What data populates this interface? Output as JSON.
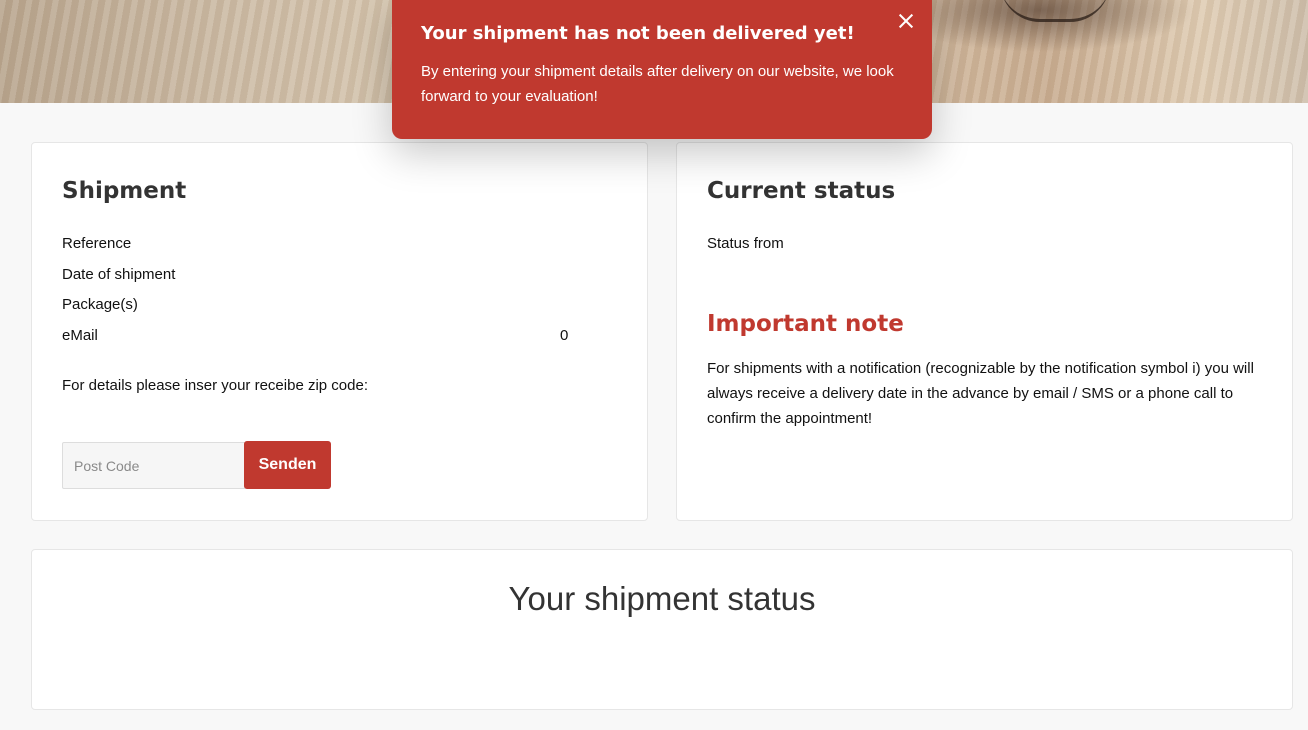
{
  "notification": {
    "title": "Your shipment has not been delivered yet!",
    "message": "By entering your shipment details after delivery on our website, we look forward to your evaluation!",
    "close_icon": "close-icon"
  },
  "shipment": {
    "heading": "Shipment",
    "rows": [
      {
        "label": "Reference",
        "value": ""
      },
      {
        "label": "Date of shipment",
        "value": ""
      },
      {
        "label": "Package(s)",
        "value": ""
      },
      {
        "label": "eMail",
        "value": "0"
      }
    ],
    "zip_prompt": "For details please inser your receibe zip code:",
    "postcode_placeholder": "Post Code",
    "submit_label": "Senden"
  },
  "current_status": {
    "heading": "Current status",
    "status_from": "Status from",
    "note_heading": "Important note",
    "note_text": "For shipments with a notification (recognizable by the notification symbol i) you will always receive a delivery date in the advance by email / SMS or a phone call to confirm the appointment!"
  },
  "shipment_status": {
    "title": "Your shipment status"
  },
  "colors": {
    "accent": "#c0392f",
    "background": "#f8f8f8",
    "card": "#ffffff"
  }
}
